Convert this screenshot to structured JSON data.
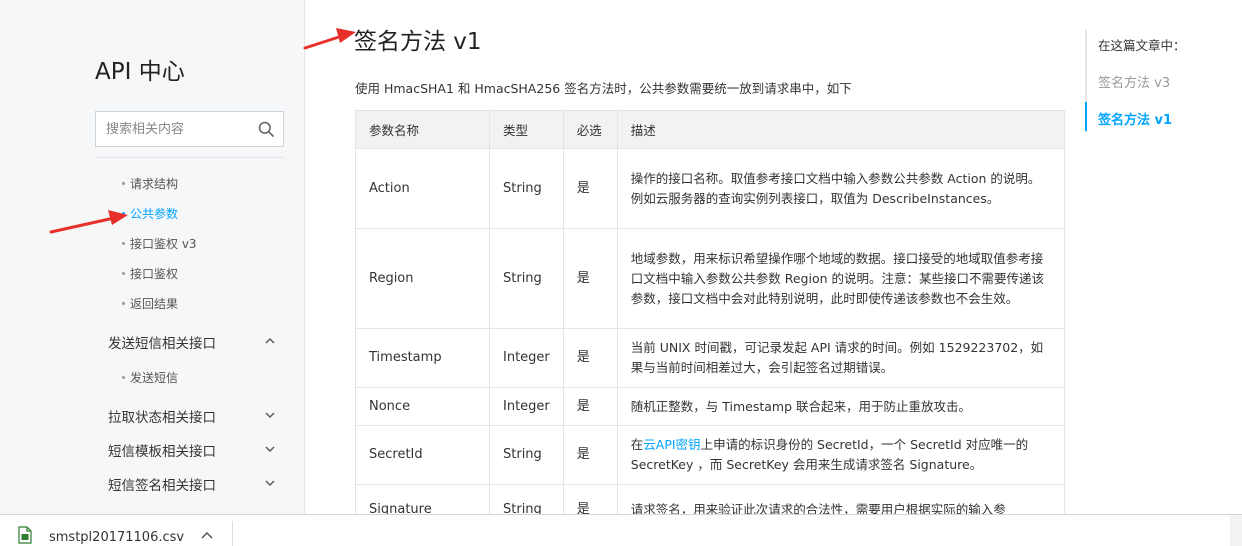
{
  "sidebar": {
    "brand": "API 中心",
    "search_placeholder": "搜索相关内容",
    "sub_items": [
      "请求结构",
      "公共参数",
      "接口鉴权 v3",
      "接口鉴权",
      "返回结果"
    ],
    "groups": [
      {
        "label": "发送短信相关接口",
        "expanded": true,
        "children": [
          "发送短信"
        ]
      },
      {
        "label": "拉取状态相关接口",
        "expanded": false
      },
      {
        "label": "短信模板相关接口",
        "expanded": false
      },
      {
        "label": "短信签名相关接口",
        "expanded": false
      }
    ],
    "active_item": "公共参数"
  },
  "main": {
    "title": "签名方法 v1",
    "intro": "使用 HmacSHA1 和 HmacSHA256 签名方法时，公共参数需要统一放到请求串中，如下",
    "table": {
      "headers": [
        "参数名称",
        "类型",
        "必选",
        "描述"
      ],
      "rows": [
        {
          "name": "Action",
          "type": "String",
          "required": "是",
          "desc": "操作的接口名称。取值参考接口文档中输入参数公共参数 Action 的说明。例如云服务器的查询实例列表接口，取值为 DescribeInstances。"
        },
        {
          "name": "Region",
          "type": "String",
          "required": "是",
          "desc": "地域参数，用来标识希望操作哪个地域的数据。接口接受的地域取值参考接口文档中输入参数公共参数 Region 的说明。注意：某些接口不需要传递该参数，接口文档中会对此特别说明，此时即使传递该参数也不会生效。"
        },
        {
          "name": "Timestamp",
          "type": "Integer",
          "required": "是",
          "desc": "当前 UNIX 时间戳，可记录发起 API 请求的时间。例如 1529223702，如果与当前时间相差过大，会引起签名过期错误。"
        },
        {
          "name": "Nonce",
          "type": "Integer",
          "required": "是",
          "desc": "随机正整数，与 Timestamp 联合起来，用于防止重放攻击。"
        },
        {
          "name": "SecretId",
          "type": "String",
          "required": "是",
          "desc_pre": "在",
          "desc_link": "云API密钥",
          "desc_post": "上申请的标识身份的 SecretId，一个 SecretId 对应唯一的 SecretKey ，而 SecretKey 会用来生成请求签名 Signature。"
        },
        {
          "name": "Signature",
          "type": "String",
          "required": "是",
          "desc": "请求签名，用来验证此次请求的合法性，需要用户根据实际的输入参"
        }
      ]
    }
  },
  "toc": {
    "title": "在这篇文章中：",
    "items": [
      {
        "label": "签名方法 v3",
        "active": false
      },
      {
        "label": "签名方法 v1",
        "active": true
      }
    ]
  },
  "download_bar": {
    "filename": "smstpl20171106.csv"
  },
  "colors": {
    "accent": "#00a4ff",
    "annotation": "#e8302b"
  }
}
